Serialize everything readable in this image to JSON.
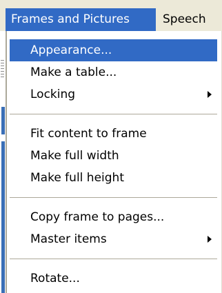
{
  "menubar": {
    "items": [
      {
        "label": "Frames and Pictures",
        "active": true
      },
      {
        "label": "Speech",
        "active": false
      }
    ]
  },
  "menu": {
    "groups": [
      [
        {
          "label": "Appearance...",
          "highlighted": true,
          "submenu": false
        },
        {
          "label": "Make a table...",
          "highlighted": false,
          "submenu": false
        },
        {
          "label": "Locking",
          "highlighted": false,
          "submenu": true
        }
      ],
      [
        {
          "label": "Fit content to frame",
          "highlighted": false,
          "submenu": false
        },
        {
          "label": "Make full width",
          "highlighted": false,
          "submenu": false
        },
        {
          "label": "Make full height",
          "highlighted": false,
          "submenu": false
        }
      ],
      [
        {
          "label": "Copy frame to pages...",
          "highlighted": false,
          "submenu": false
        },
        {
          "label": "Master items",
          "highlighted": false,
          "submenu": true
        }
      ],
      [
        {
          "label": "Rotate...",
          "highlighted": false,
          "submenu": false
        }
      ]
    ]
  },
  "colors": {
    "highlight": "#316ac5",
    "menubar_background": "#ece9d8",
    "menu_background": "#ffffff",
    "separator": "#aca899"
  },
  "icons": {
    "submenu_indicator": "triangle-right-icon"
  }
}
